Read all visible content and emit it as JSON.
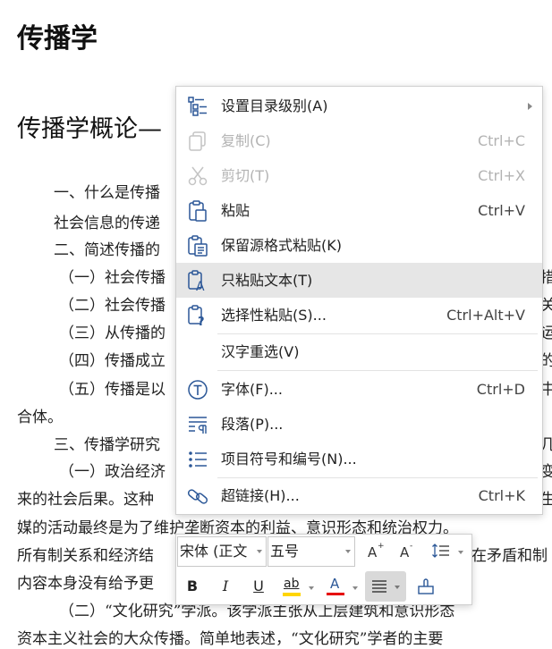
{
  "document": {
    "title": "传播学",
    "subtitle": "传播学概论—",
    "lines": [
      "一、什么是传播",
      "社会信息的传递",
      "二、简述传播的",
      "（一）社会传播",
      "（二）社会传播",
      "（三）从传播的",
      "（四）传播成立",
      "（五）传播是以",
      "合体。",
      "三、传播学研究",
      "（一）政治经济",
      "来的社会后果。这种",
      "媒的活动最终是为了维护垄断资本的利益、意识形态和统治权力。",
      "所有制关系和经济结",
      "内容本身没有给予更",
      "（二）“文化研究”学派。该学派主张从上层建筑和意识形态",
      "资本主义社会的大众传播。简单地表述，“文化研究”学者的主要"
    ],
    "right_fragments": [
      "措",
      "关",
      "运",
      "的",
      "中",
      "几",
      "变",
      "生",
      "在矛盾和制"
    ]
  },
  "context_menu": {
    "items": [
      {
        "label": "设置目录级别(A)",
        "shortcut": "",
        "icon": "toc-level-icon",
        "submenu": true,
        "disabled": false
      },
      {
        "label": "复制(C)",
        "shortcut": "Ctrl+C",
        "icon": "copy-icon",
        "disabled": true
      },
      {
        "label": "剪切(T)",
        "shortcut": "Ctrl+X",
        "icon": "cut-icon",
        "disabled": true
      },
      {
        "label": "粘贴",
        "shortcut": "Ctrl+V",
        "icon": "paste-icon",
        "disabled": false
      },
      {
        "label": "保留源格式粘贴(K)",
        "shortcut": "",
        "icon": "paste-keep-format-icon",
        "disabled": false
      },
      {
        "label": "只粘贴文本(T)",
        "shortcut": "",
        "icon": "paste-text-only-icon",
        "disabled": false,
        "highlighted": true
      },
      {
        "label": "选择性粘贴(S)...",
        "shortcut": "Ctrl+Alt+V",
        "icon": "paste-special-icon",
        "disabled": false
      },
      {
        "label": "汉字重选(V)",
        "shortcut": "",
        "icon": "",
        "disabled": false
      },
      {
        "label": "字体(F)...",
        "shortcut": "Ctrl+D",
        "icon": "font-icon",
        "disabled": false
      },
      {
        "label": "段落(P)...",
        "shortcut": "",
        "icon": "paragraph-icon",
        "disabled": false
      },
      {
        "label": "项目符号和编号(N)...",
        "shortcut": "",
        "icon": "bullets-numbering-icon",
        "disabled": false
      },
      {
        "label": "超链接(H)...",
        "shortcut": "Ctrl+K",
        "icon": "hyperlink-icon",
        "disabled": false
      }
    ]
  },
  "mini_toolbar": {
    "font_name": "宋体 (正文",
    "font_size": "五号",
    "buttons": {
      "bold": "B",
      "italic": "I",
      "underline": "U",
      "highlight": "ab",
      "font_color": "A"
    }
  },
  "colors": {
    "accent_blue": "#2b5797",
    "highlight_yellow": "#ffd500",
    "font_red": "#e60000",
    "menu_hover": "#e6e6e6"
  }
}
